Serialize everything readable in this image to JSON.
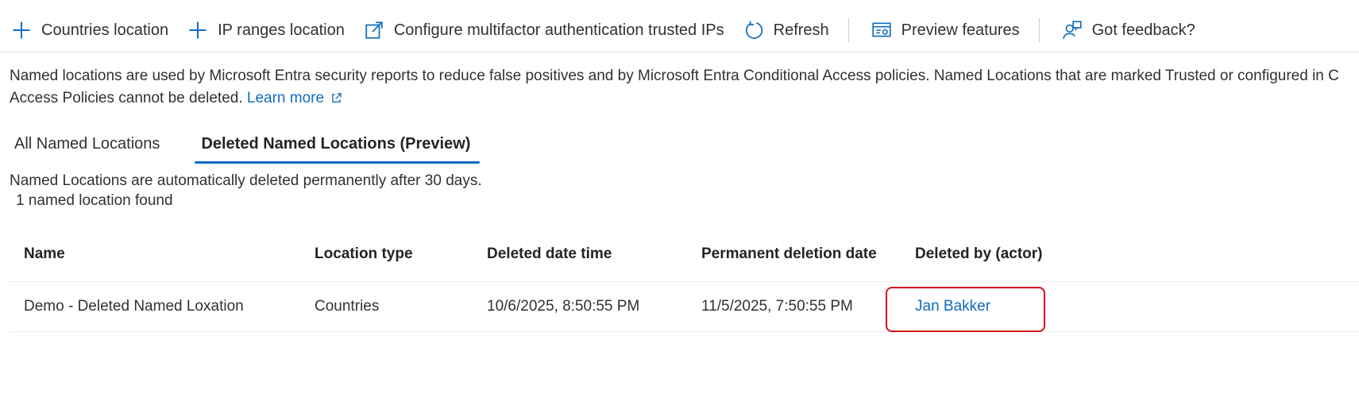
{
  "toolbar": {
    "countries_location": "Countries location",
    "ip_ranges_location": "IP ranges location",
    "configure_mfa": "Configure multifactor authentication trusted IPs",
    "refresh": "Refresh",
    "preview_features": "Preview features",
    "got_feedback": "Got feedback?"
  },
  "description": {
    "line1": "Named locations are used by Microsoft Entra security reports to reduce false positives and by Microsoft Entra Conditional Access policies. Named Locations that are marked Trusted or configured in C",
    "line2": "Access Policies cannot be deleted.",
    "learn_more": "Learn more"
  },
  "tabs": [
    {
      "label": "All Named Locations",
      "active": false
    },
    {
      "label": "Deleted Named Locations (Preview)",
      "active": true
    }
  ],
  "notice": "Named Locations are automatically deleted permanently after 30 days.",
  "count_text": "1 named location found",
  "table": {
    "columns": [
      "Name",
      "Location type",
      "Deleted date time",
      "Permanent deletion date",
      "Deleted by (actor)"
    ],
    "rows": [
      {
        "name": "Demo - Deleted Named Loxation",
        "location_type": "Countries",
        "deleted_date_time": "10/6/2025, 8:50:55 PM",
        "permanent_deletion_date": "11/5/2025, 7:50:55 PM",
        "deleted_by": "Jan Bakker"
      }
    ]
  },
  "colors": {
    "accent": "#0f6cbd",
    "highlight": "#d40f1f"
  }
}
